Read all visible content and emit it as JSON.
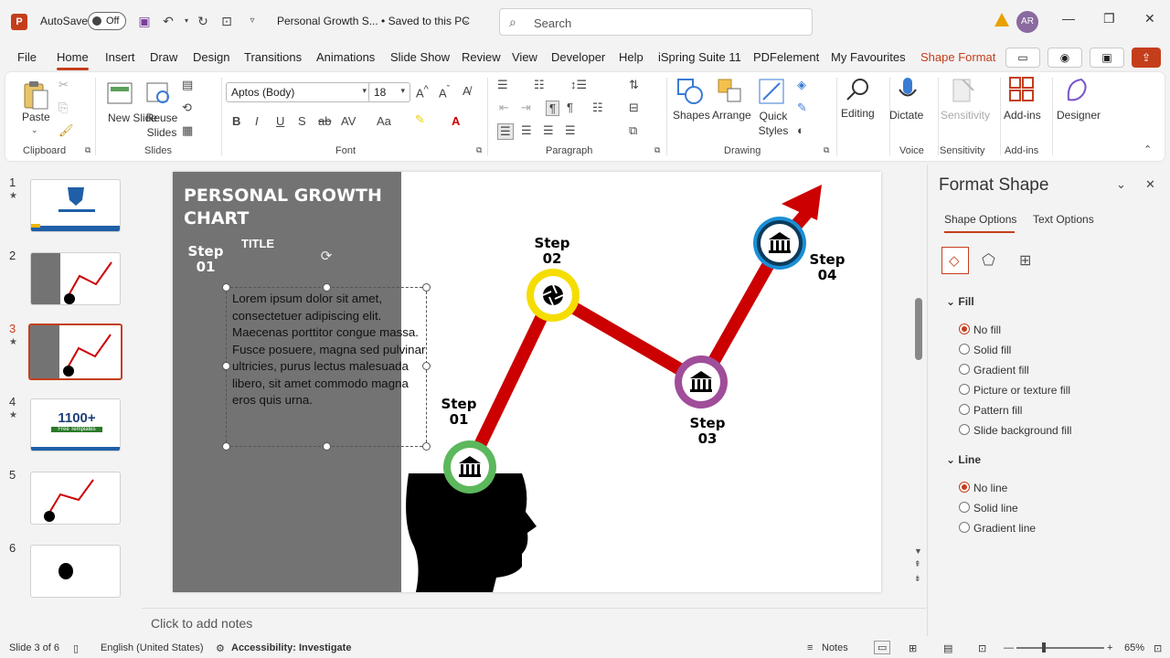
{
  "titlebar": {
    "autosave_label": "AutoSave",
    "autosave_state": "Off",
    "doc_title": "Personal Growth S... • Saved to this PC",
    "search_placeholder": "Search",
    "avatar_initials": "AR"
  },
  "menu": {
    "tabs": [
      "File",
      "Home",
      "Insert",
      "Draw",
      "Design",
      "Transitions",
      "Animations",
      "Slide Show",
      "Review",
      "View",
      "Developer",
      "Help",
      "iSpring Suite 11",
      "PDFelement",
      "My Favourites",
      "Shape Format"
    ],
    "active": "Home"
  },
  "ribbon": {
    "clipboard": {
      "paste": "Paste",
      "label": "Clipboard"
    },
    "slides": {
      "new_slide": "New Slide",
      "reuse_slides": "Reuse Slides",
      "label": "Slides"
    },
    "font": {
      "name": "Aptos (Body)",
      "size": "18",
      "label": "Font"
    },
    "paragraph": {
      "label": "Paragraph"
    },
    "drawing": {
      "shapes": "Shapes",
      "arrange": "Arrange",
      "quick_styles": "Quick Styles",
      "label": "Drawing"
    },
    "editing": {
      "label": "Editing"
    },
    "voice": {
      "dictate": "Dictate",
      "label": "Voice"
    },
    "sensitivity": {
      "button": "Sensitivity",
      "label": "Sensitivity"
    },
    "addins": {
      "button": "Add-ins",
      "label": "Add-ins"
    },
    "designer": {
      "button": "Designer"
    }
  },
  "thumbnails": [
    {
      "num": "1",
      "star": "★"
    },
    {
      "num": "2",
      "star": ""
    },
    {
      "num": "3",
      "star": "★"
    },
    {
      "num": "4",
      "star": "★"
    },
    {
      "num": "5",
      "star": ""
    },
    {
      "num": "6",
      "star": ""
    }
  ],
  "thumb4_text": "1100+",
  "thumb4_sub": "Free Templates",
  "slide": {
    "title": "PERSONAL GROWTH CHART",
    "step_left": "Step 01",
    "title_label": "TITLE",
    "body": "Lorem ipsum dolor sit amet, consectetuer adipiscing elit. Maecenas porttitor congue massa. Fusce posuere, magna sed pulvinar ultricies, purus lectus malesuada libero, sit amet commodo magna eros quis urna.",
    "step1": "Step 01",
    "step2": "Step 02",
    "step3": "Step 03",
    "step4": "Step 04"
  },
  "format_pane": {
    "title": "Format Shape",
    "tab_shape": "Shape Options",
    "tab_text": "Text Options",
    "fill_header": "Fill",
    "fill_options": [
      "No fill",
      "Solid fill",
      "Gradient fill",
      "Picture or texture fill",
      "Pattern fill",
      "Slide background fill"
    ],
    "line_header": "Line",
    "line_options": [
      "No line",
      "Solid line",
      "Gradient line"
    ]
  },
  "notes_placeholder": "Click to add notes",
  "status": {
    "slide_count": "Slide 3 of 6",
    "language": "English (United States)",
    "accessibility": "Accessibility: Investigate",
    "notes": "Notes",
    "zoom": "65%"
  },
  "colors": {
    "accent": "#c43e1c",
    "arrow_red": "#cc0000"
  }
}
